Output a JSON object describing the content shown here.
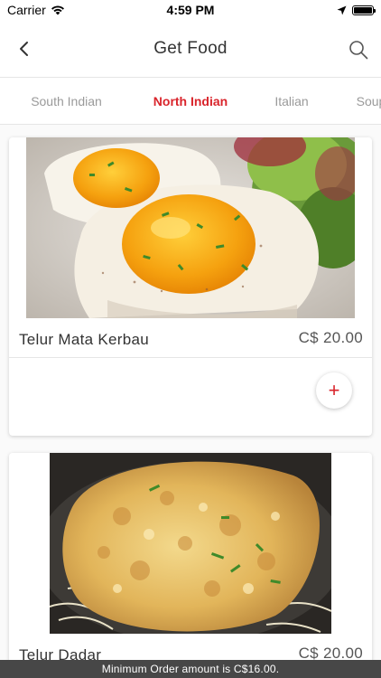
{
  "status_bar": {
    "carrier": "Carrier",
    "time": "4:59 PM"
  },
  "header": {
    "title": "Get Food"
  },
  "tabs": [
    {
      "label": "South Indian",
      "active": false
    },
    {
      "label": "North Indian",
      "active": true
    },
    {
      "label": "Italian",
      "active": false
    },
    {
      "label": "Soup",
      "active": false
    }
  ],
  "food_items": [
    {
      "name": "Telur Mata Kerbau",
      "price": "C$ 20.00",
      "add_label": "+"
    },
    {
      "name": "Telur Dadar",
      "price": "C$ 20.00"
    }
  ],
  "footer": {
    "min_order_text": "Minimum Order amount is C$16.00."
  },
  "colors": {
    "accent": "#d9242b",
    "footer_bg": "#474747"
  }
}
